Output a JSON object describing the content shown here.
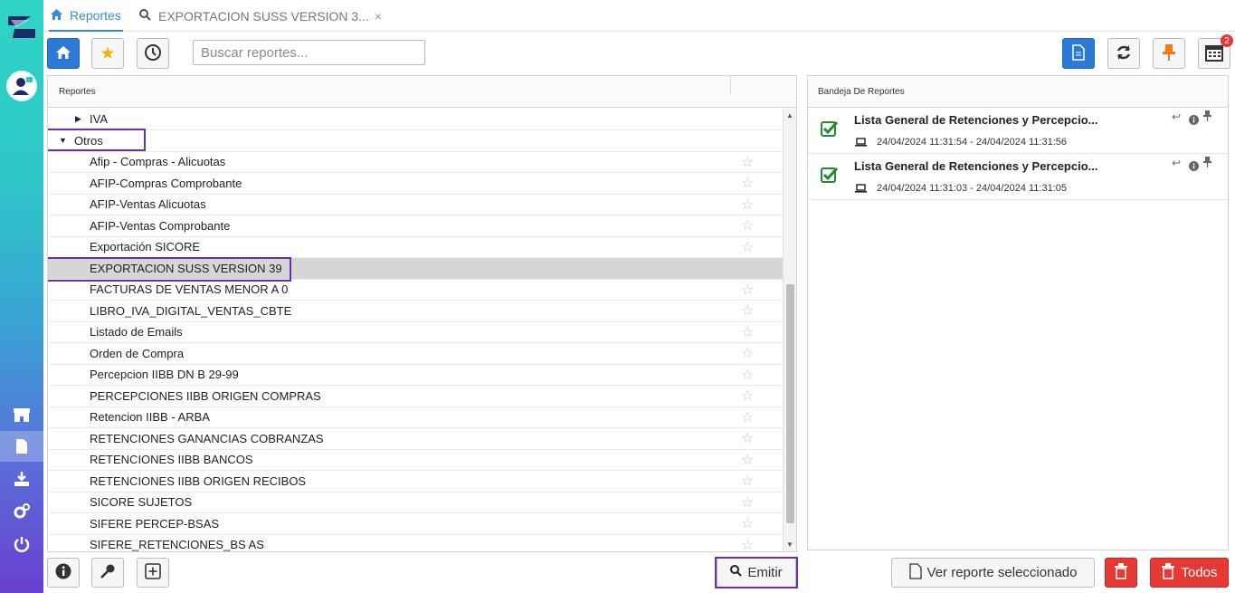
{
  "tabs": [
    {
      "label": "Reportes",
      "icon": "home-icon"
    },
    {
      "label": "EXPORTACION SUSS VERSION 3...",
      "icon": "search-icon"
    }
  ],
  "search": {
    "placeholder": "Buscar reportes..."
  },
  "toolbar": {
    "badge_count": "2"
  },
  "left_panel": {
    "header": "Reportes",
    "rows": [
      {
        "label": "IVA",
        "type": "group-collapsed"
      },
      {
        "label": "Otros",
        "type": "group-expanded"
      },
      {
        "label": "Afip - Compras - Alicuotas"
      },
      {
        "label": "AFIP-Compras Comprobante"
      },
      {
        "label": "AFIP-Ventas Alicuotas"
      },
      {
        "label": "AFIP-Ventas Comprobante"
      },
      {
        "label": "Exportación SICORE"
      },
      {
        "label": "EXPORTACION SUSS VERSION 39",
        "selected": true
      },
      {
        "label": "FACTURAS DE VENTAS MENOR A 0"
      },
      {
        "label": "LIBRO_IVA_DIGITAL_VENTAS_CBTE"
      },
      {
        "label": "Listado de Emails"
      },
      {
        "label": "Orden de Compra"
      },
      {
        "label": "Percepcion IIBB DN B 29-99"
      },
      {
        "label": "PERCEPCIONES IIBB ORIGEN COMPRAS"
      },
      {
        "label": "Retencion IIBB - ARBA"
      },
      {
        "label": "RETENCIONES GANANCIAS COBRANZAS"
      },
      {
        "label": "RETENCIONES IIBB BANCOS"
      },
      {
        "label": "RETENCIONES IIBB ORIGEN RECIBOS"
      },
      {
        "label": "SICORE SUJETOS"
      },
      {
        "label": "SIFERE PERCEP-BSAS"
      },
      {
        "label": "SIFERE_RETENCIONES_BS AS"
      }
    ]
  },
  "right_panel": {
    "header": "Bandeja De Reportes",
    "items": [
      {
        "title": "Lista General de Retenciones y Percepcio...",
        "range": "24/04/2024 11:31:54 - 24/04/2024 11:31:56"
      },
      {
        "title": "Lista General de Retenciones y Percepcio...",
        "range": "24/04/2024 11:31:03 - 24/04/2024 11:31:05"
      }
    ]
  },
  "bottom": {
    "emitir": "Emitir",
    "ver": "Ver reporte seleccionado",
    "todos": "Todos"
  },
  "colors": {
    "accent": "#2a7ad6",
    "highlight": "#6a2fb0",
    "danger": "#e53935"
  }
}
